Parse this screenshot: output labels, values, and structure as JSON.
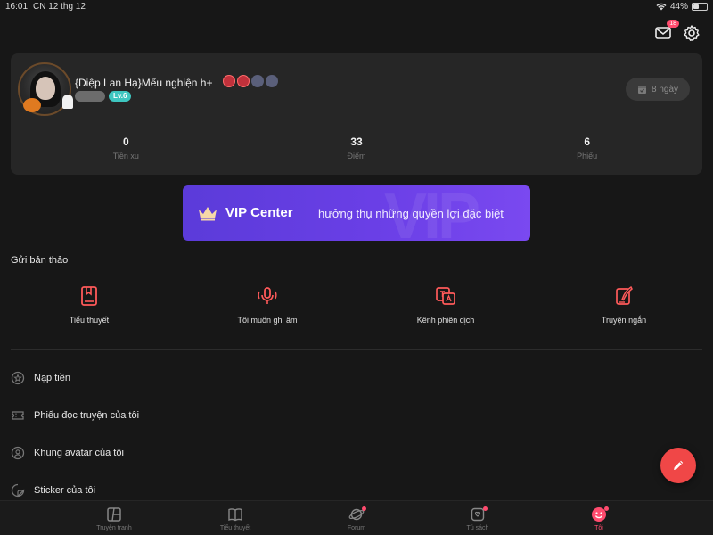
{
  "status_bar": {
    "time": "16:01",
    "date": "CN 12 thg 12",
    "battery": "44%",
    "battery_level": 0.44
  },
  "header": {
    "mail_badge": "18"
  },
  "profile": {
    "username": "{Diệp Lan Hạ}Mếu nghiện h+",
    "level": "Lv.6",
    "checkin_days": "8 ngày",
    "stats": [
      {
        "value": "0",
        "label": "Tiền xu"
      },
      {
        "value": "33",
        "label": "Điểm"
      },
      {
        "value": "6",
        "label": "Phiếu"
      }
    ]
  },
  "vip": {
    "title": "VIP Center",
    "subtitle": "hưởng thụ những quyền lợi đặc biệt",
    "watermark": "VIP"
  },
  "drafts": {
    "title": "Gửi bản thảo",
    "items": [
      {
        "label": "Tiểu thuyết",
        "icon": "book-icon"
      },
      {
        "label": "Tôi muốn ghi âm",
        "icon": "microphone-icon"
      },
      {
        "label": "Kênh phiên dịch",
        "icon": "translate-icon"
      },
      {
        "label": "Truyện ngắn",
        "icon": "quill-icon"
      }
    ]
  },
  "menu": [
    {
      "label": "Nạp tiền",
      "icon": "coin-icon"
    },
    {
      "label": "Phiếu đọc truyện của tôi",
      "icon": "ticket-icon"
    },
    {
      "label": "Khung avatar của tôi",
      "icon": "avatar-frame-icon"
    },
    {
      "label": "Sticker của tôi",
      "icon": "sticker-icon"
    }
  ],
  "bottom_nav": [
    {
      "label": "Truyện tranh",
      "active": false,
      "dot": false
    },
    {
      "label": "Tiểu thuyết",
      "active": false,
      "dot": false
    },
    {
      "label": "Forum",
      "active": false,
      "dot": true
    },
    {
      "label": "Tủ sách",
      "active": false,
      "dot": true
    },
    {
      "label": "Tôi",
      "active": true,
      "dot": true
    }
  ],
  "colors": {
    "accent": "#ff4b6e",
    "vip_start": "#5b3bd9",
    "vip_end": "#7a49f0",
    "level_badge": "#3ec6c0",
    "fab": "#f04747"
  }
}
